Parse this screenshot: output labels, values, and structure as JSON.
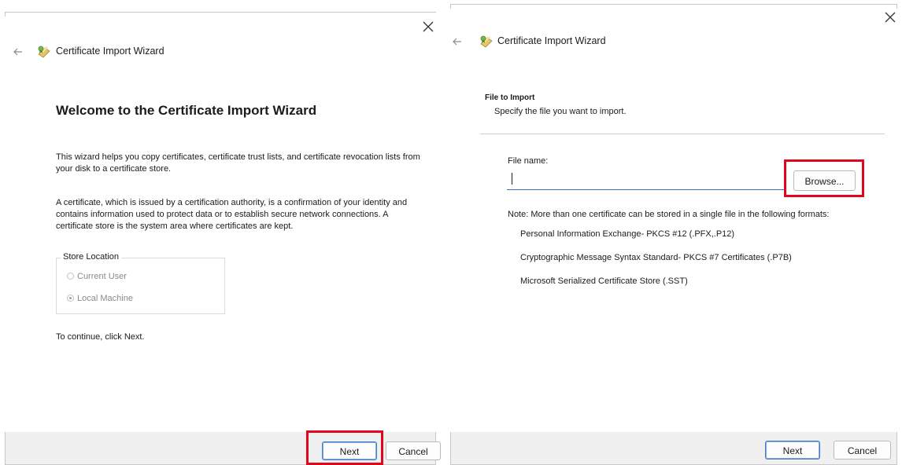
{
  "left_dialog": {
    "window_title": "Certificate Import Wizard",
    "heading": "Welcome to the Certificate Import Wizard",
    "paragraph1": "This wizard helps you copy certificates, certificate trust lists, and certificate revocation lists from your disk to a certificate store.",
    "paragraph2": "A certificate, which is issued by a certification authority, is a confirmation of your identity and contains information used to protect data or to establish secure network connections. A certificate store is the system area where certificates are kept.",
    "store_location": {
      "legend": "Store Location",
      "options": [
        "Current User",
        "Local Machine"
      ],
      "selected": "Local Machine"
    },
    "continue_text": "To continue, click Next.",
    "buttons": {
      "next": "Next",
      "cancel": "Cancel"
    }
  },
  "right_dialog": {
    "window_title": "Certificate Import Wizard",
    "section_heading": "File to Import",
    "section_subheading": "Specify the file you want to import.",
    "file_name_label": "File name:",
    "file_name_value": "",
    "browse_label": "Browse...",
    "note": "Note:  More than one certificate can be stored in a single file in the following formats:",
    "formats": [
      "Personal Information Exchange- PKCS #12 (.PFX,.P12)",
      "Cryptographic Message Syntax Standard- PKCS #7 Certificates (.P7B)",
      "Microsoft Serialized Certificate Store (.SST)"
    ],
    "buttons": {
      "next": "Next",
      "cancel": "Cancel"
    }
  },
  "colors": {
    "highlight": "#e1061b",
    "input_underline": "#3a6fb7",
    "footer_bg": "#f0f0f0"
  },
  "icons": [
    "close-icon",
    "back-arrow-icon",
    "certificate-icon"
  ]
}
